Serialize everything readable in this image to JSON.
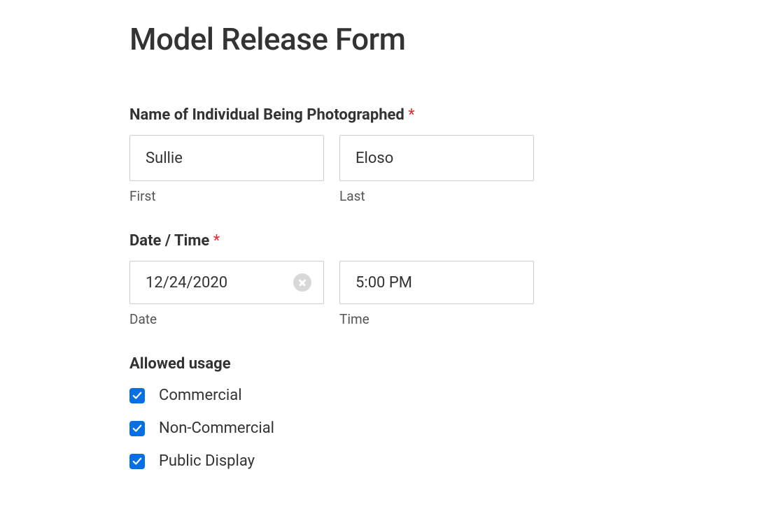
{
  "form": {
    "title": "Model Release Form",
    "name_section": {
      "label": "Name of Individual Being Photographed",
      "required_marker": "*",
      "first": {
        "value": "Sullie",
        "sub_label": "First"
      },
      "last": {
        "value": "Eloso",
        "sub_label": "Last"
      }
    },
    "datetime_section": {
      "label": "Date / Time",
      "required_marker": "*",
      "date": {
        "value": "12/24/2020",
        "sub_label": "Date"
      },
      "time": {
        "value": "5:00 PM",
        "sub_label": "Time"
      }
    },
    "usage_section": {
      "label": "Allowed usage",
      "options": [
        {
          "label": "Commercial",
          "checked": true
        },
        {
          "label": "Non-Commercial",
          "checked": true
        },
        {
          "label": "Public Display",
          "checked": true
        }
      ]
    }
  }
}
